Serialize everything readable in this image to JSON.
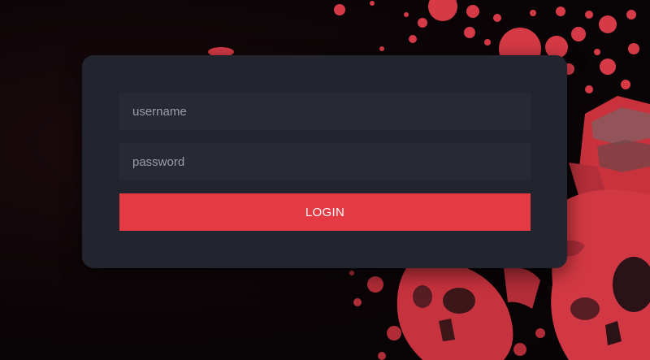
{
  "login_form": {
    "username_placeholder": "username",
    "password_placeholder": "password",
    "login_label": "LOGIN"
  },
  "colors": {
    "page_background": "#0b0507",
    "card_background": "#22252d",
    "field_background": "#272a33",
    "accent": "#e53a44",
    "artwork_red": "#d63a46"
  },
  "background": {
    "artwork": "red-skull-splatter"
  }
}
